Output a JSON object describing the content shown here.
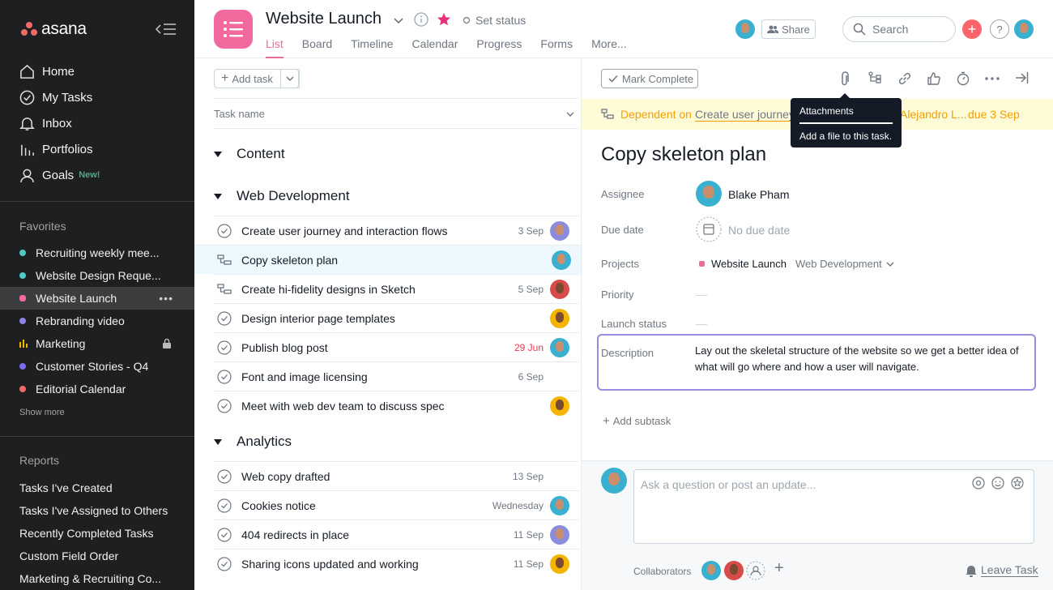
{
  "sidebar": {
    "logo_text": "asana",
    "nav": [
      {
        "label": "Home",
        "icon": "home-icon"
      },
      {
        "label": "My Tasks",
        "icon": "check-circle-icon"
      },
      {
        "label": "Inbox",
        "icon": "bell-icon"
      },
      {
        "label": "Portfolios",
        "icon": "bar-chart-icon"
      },
      {
        "label": "Goals",
        "icon": "person-icon",
        "badge": "New!"
      }
    ],
    "favorites_title": "Favorites",
    "favorites": [
      {
        "label": "Recruiting weekly mee...",
        "color": "#4ecbc4"
      },
      {
        "label": "Website Design Reque...",
        "color": "#4ecbc4"
      },
      {
        "label": "Website Launch",
        "color": "#f06a9e",
        "active": true
      },
      {
        "label": "Rebranding video",
        "color": "#8d84e8"
      },
      {
        "label": "Marketing",
        "color": "#f5b400",
        "locked": true
      },
      {
        "label": "Customer Stories - Q4",
        "color": "#7c6cf0"
      },
      {
        "label": "Editorial Calendar",
        "color": "#f06a6a"
      }
    ],
    "show_more": "Show more",
    "reports_title": "Reports",
    "reports": [
      "Tasks I've Created",
      "Tasks I've Assigned to Others",
      "Recently Completed Tasks",
      "Custom Field Order",
      "Marketing & Recruiting Co..."
    ]
  },
  "header": {
    "project_title": "Website Launch",
    "set_status": "Set status",
    "tabs": [
      "List",
      "Board",
      "Timeline",
      "Calendar",
      "Progress",
      "Forms",
      "More..."
    ],
    "active_tab": "List",
    "share_label": "Share",
    "search_placeholder": "Search",
    "accent": "#f06a9e"
  },
  "list": {
    "add_task_label": "Add task",
    "column_header": "Task name",
    "sections": [
      {
        "name": "Content",
        "tasks": []
      },
      {
        "name": "Web Development",
        "tasks": [
          {
            "name": "Create user journey and interaction flows",
            "date": "3 Sep",
            "type": "check",
            "avatar": "purple"
          },
          {
            "name": "Copy skeleton plan",
            "date": "",
            "type": "dependency",
            "avatar": "blue",
            "selected": true
          },
          {
            "name": "Create hi-fidelity designs in Sketch",
            "date": "5 Sep",
            "type": "dependency",
            "avatar": "red"
          },
          {
            "name": "Design interior page templates",
            "date": "",
            "type": "check",
            "avatar": "yellow"
          },
          {
            "name": "Publish blog post",
            "date": "29 Jun",
            "date_overdue": true,
            "type": "check",
            "avatar": "blue"
          },
          {
            "name": "Font and image licensing",
            "date": "6 Sep",
            "type": "check",
            "avatar": ""
          },
          {
            "name": "Meet with web dev team to discuss spec",
            "date": "",
            "type": "check",
            "avatar": "yellow"
          }
        ]
      },
      {
        "name": "Analytics",
        "tasks": [
          {
            "name": "Web copy drafted",
            "date": "13 Sep",
            "type": "check",
            "avatar": ""
          },
          {
            "name": "Cookies notice",
            "date": "Wednesday",
            "type": "check",
            "avatar": "blue"
          },
          {
            "name": "404 redirects in place",
            "date": "11 Sep",
            "type": "check",
            "avatar": "purple"
          },
          {
            "name": "Sharing icons updated and working",
            "date": "11 Sep",
            "type": "check",
            "avatar": "yellow"
          }
        ]
      }
    ]
  },
  "detail": {
    "mark_complete": "Mark Complete",
    "dependency": {
      "prefix": "Dependent on",
      "task": "Create user journey",
      "assignee": "Alejandro L...",
      "due": "due 3 Sep"
    },
    "title": "Copy skeleton plan",
    "fields": {
      "assignee_label": "Assignee",
      "assignee": "Blake Pham",
      "due_label": "Due date",
      "due": "No due date",
      "projects_label": "Projects",
      "project": "Website Launch",
      "section": "Web Development",
      "priority_label": "Priority",
      "priority": "—",
      "launch_label": "Launch status",
      "launch": "—",
      "description_label": "Description",
      "description": "Lay out the skeletal structure of the website so we get a better idea of what will go where and how a user will navigate."
    },
    "add_subtask": "Add subtask",
    "comment_placeholder": "Ask a question or post an update...",
    "collaborators_label": "Collaborators",
    "leave_task": "Leave Task"
  },
  "tooltip": {
    "title": "Attachments",
    "body": "Add a file to this task."
  }
}
